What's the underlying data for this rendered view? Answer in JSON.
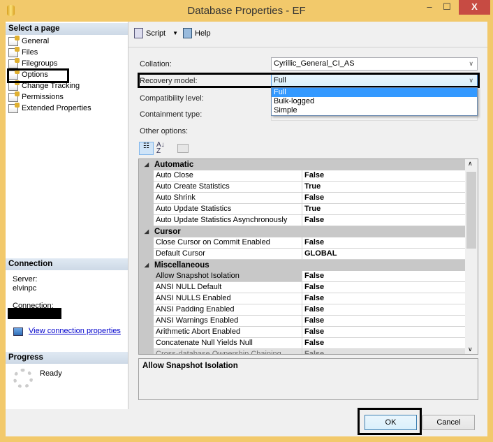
{
  "window": {
    "title": "Database Properties - EF",
    "minimize": "–",
    "maximize": "☐",
    "close": "X"
  },
  "sidebar": {
    "header": "Select a page",
    "items": [
      {
        "label": "General"
      },
      {
        "label": "Files"
      },
      {
        "label": "Filegroups"
      },
      {
        "label": "Options"
      },
      {
        "label": "Change Tracking"
      },
      {
        "label": "Permissions"
      },
      {
        "label": "Extended Properties"
      }
    ],
    "selected": "Options"
  },
  "connection": {
    "header": "Connection",
    "server_label": "Server:",
    "server_value": "elvinpc",
    "connection_label": "Connection:",
    "link": "View connection properties"
  },
  "progress": {
    "header": "Progress",
    "status": "Ready"
  },
  "toolbar": {
    "script": "Script",
    "help": "Help"
  },
  "form": {
    "collation_label": "Collation:",
    "collation_value": "Cyrillic_General_CI_AS",
    "recovery_label": "Recovery model:",
    "recovery_value": "Full",
    "recovery_options": [
      "Full",
      "Bulk-logged",
      "Simple"
    ],
    "compat_label": "Compatibility level:",
    "containment_label": "Containment type:",
    "other_label": "Other options:"
  },
  "grid": {
    "categories": [
      {
        "name": "Automatic",
        "props": [
          [
            "Auto Close",
            "False"
          ],
          [
            "Auto Create Statistics",
            "True"
          ],
          [
            "Auto Shrink",
            "False"
          ],
          [
            "Auto Update Statistics",
            "True"
          ],
          [
            "Auto Update Statistics Asynchronously",
            "False"
          ]
        ]
      },
      {
        "name": "Cursor",
        "props": [
          [
            "Close Cursor on Commit Enabled",
            "False"
          ],
          [
            "Default Cursor",
            "GLOBAL"
          ]
        ]
      },
      {
        "name": "Miscellaneous",
        "props": [
          [
            "Allow Snapshot Isolation",
            "False"
          ],
          [
            "ANSI NULL Default",
            "False"
          ],
          [
            "ANSI NULLS Enabled",
            "False"
          ],
          [
            "ANSI Padding Enabled",
            "False"
          ],
          [
            "ANSI Warnings Enabled",
            "False"
          ],
          [
            "Arithmetic Abort Enabled",
            "False"
          ],
          [
            "Concatenate Null Yields Null",
            "False"
          ],
          [
            "Cross-database Ownership Chaining Enabled",
            "False"
          ]
        ]
      }
    ]
  },
  "description": "Allow Snapshot Isolation",
  "buttons": {
    "ok": "OK",
    "cancel": "Cancel"
  }
}
